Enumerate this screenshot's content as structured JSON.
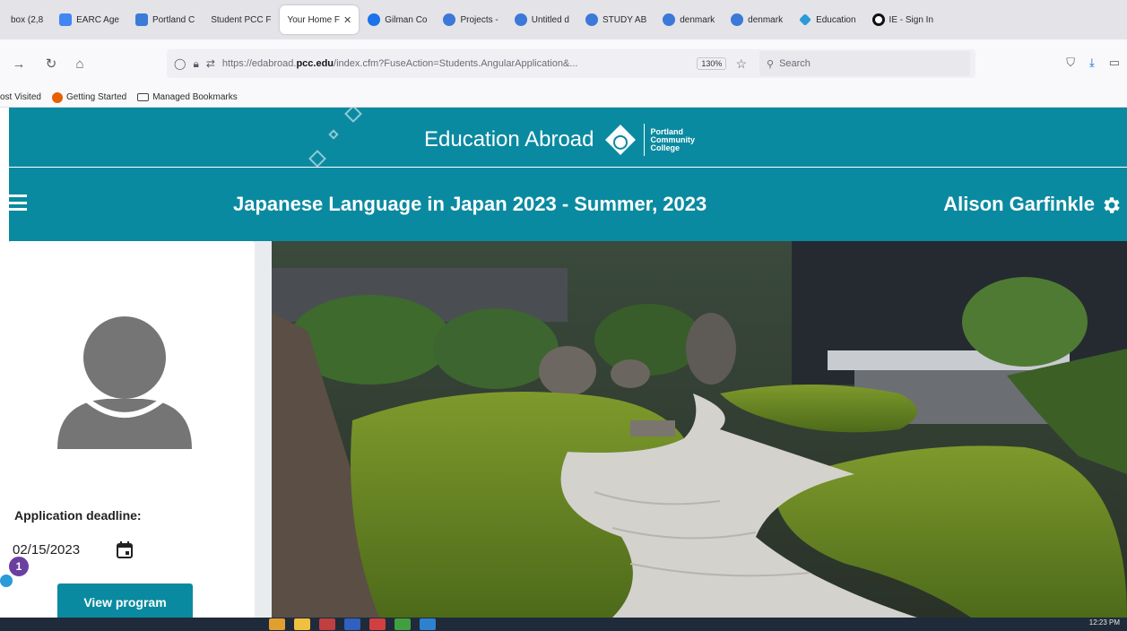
{
  "browser": {
    "tabs": [
      {
        "label": "box (2,8",
        "color": "#c5221f",
        "active": false
      },
      {
        "label": "EARC Age",
        "color": "#4285f4",
        "active": false
      },
      {
        "label": "Portland C",
        "color": "#3b7bd8",
        "active": false
      },
      {
        "label": "Student PCC F",
        "color": "#cccccc",
        "active": false
      },
      {
        "label": "Your Home F",
        "color": "#ffffff",
        "active": true
      },
      {
        "label": "Gilman Co",
        "color": "#1a73e8",
        "active": false
      },
      {
        "label": "Projects -",
        "color": "#3c78d8",
        "active": false
      },
      {
        "label": "Untitled d",
        "color": "#3c78d8",
        "active": false
      },
      {
        "label": "STUDY AB",
        "color": "#3c78d8",
        "active": false
      },
      {
        "label": "denmark",
        "color": "#3c78d8",
        "active": false
      },
      {
        "label": "denmark",
        "color": "#3c78d8",
        "active": false
      },
      {
        "label": "Education",
        "color": "#2a9ad8",
        "active": false
      },
      {
        "label": "IE - Sign In",
        "color": "#111111",
        "active": false
      }
    ],
    "url_prefix": "https://edabroad.",
    "url_domain": "pcc.edu",
    "url_rest": "/index.cfm?FuseAction=Students.AngularApplication&...",
    "zoom": "130%",
    "search_placeholder": "Search",
    "bookmarks": [
      {
        "label": "ost Visited",
        "icon": "none"
      },
      {
        "label": "Getting Started",
        "icon": "firefox-icon"
      },
      {
        "label": "Managed Bookmarks",
        "icon": "folder-icon"
      }
    ]
  },
  "site": {
    "title": "Education Abroad",
    "college_line1": "Portland",
    "college_line2": "Community",
    "college_line3": "College",
    "accent_color": "#0a8aa0"
  },
  "program": {
    "title": "Japanese Language in Japan 2023 - Summer, 2023",
    "user_name": "Alison Garfinkle"
  },
  "sidebar": {
    "deadline_label": "Application deadline:",
    "deadline_value": "02/15/2023",
    "view_button": "View program",
    "notification_count": "1"
  },
  "taskbar": {
    "clock": "12:23 PM"
  }
}
